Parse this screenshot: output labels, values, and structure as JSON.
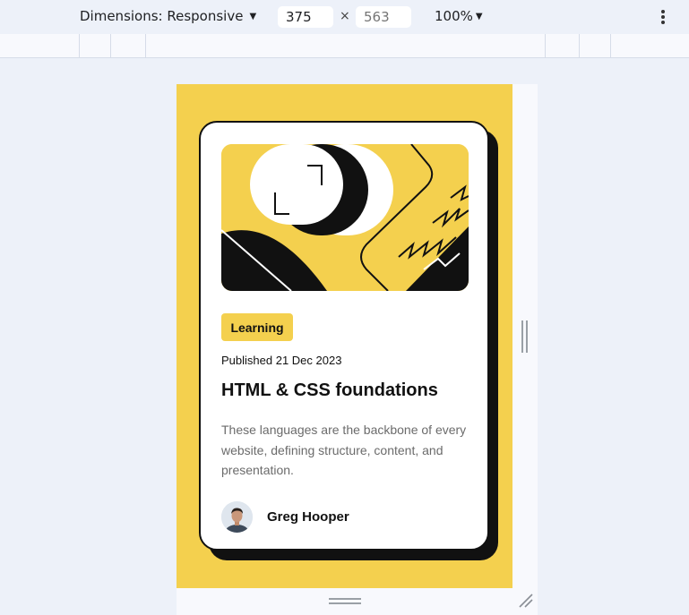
{
  "toolbar": {
    "dimensions_label": "Dimensions: Responsive",
    "width_value": "375",
    "height_placeholder": "563",
    "times_symbol": "×",
    "zoom_label": "100%",
    "caret": "▼"
  },
  "card": {
    "tag_label": "Learning",
    "published": "Published 21 Dec 2023",
    "title": "HTML & CSS foundations",
    "description": "These languages are the backbone of every website, defining structure, content, and presentation.",
    "author_name": "Greg Hooper"
  },
  "colors": {
    "accent_yellow": "#f4d04e",
    "ink": "#111111",
    "muted_text": "#6b6b6b",
    "devtools_bg": "#edf1f9"
  },
  "icons": {
    "toolbar_more": "kebab-vertical-icon",
    "resize": "resize-corner-icon"
  }
}
